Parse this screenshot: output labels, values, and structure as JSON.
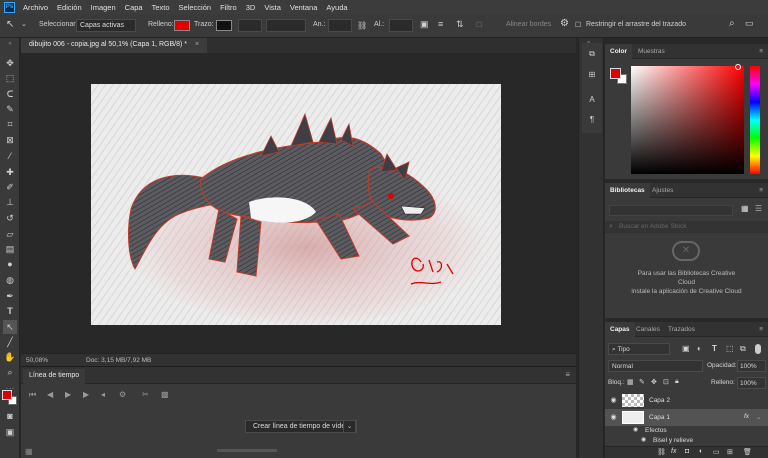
{
  "app": {
    "logo": "Ps"
  },
  "menu": [
    "Archivo",
    "Edición",
    "Imagen",
    "Capa",
    "Texto",
    "Selección",
    "Filtro",
    "3D",
    "Vista",
    "Ventana",
    "Ayuda"
  ],
  "options": {
    "select_label": "Seleccionar:",
    "select_value": "Capas activas",
    "fill_label": "Relleno:",
    "fill_color": "#e00000",
    "stroke_label": "Trazo:",
    "width_label": "An.:",
    "height_label": "Al.:",
    "align_edges": "Alinear bordes",
    "restrict_label": "Restringir el arrastre del trazado"
  },
  "document": {
    "tab_title": "dibujito 006 - copia.jpg al 50,1% (Capa 1, RGB/8) *",
    "zoom": "50,08%",
    "doc_info": "Doc: 3,15 MB/7,92 MB"
  },
  "timeline": {
    "tab": "Línea de tiempo",
    "create_button": "Crear línea de tiempo de vídeo"
  },
  "color_panel": {
    "tabs": [
      "Color",
      "Muestras"
    ],
    "foreground": "#e00000",
    "background": "#ffffff",
    "hue": "#ff0000"
  },
  "libraries_panel": {
    "tabs": [
      "Bibliotecas",
      "Ajustes"
    ],
    "search_placeholder": "Buscar en Adobe Stock",
    "message_line1": "Para usar las Bibliotecas Creative",
    "message_line2": "Cloud",
    "message_line3": "instale la aplicación de Creative Cloud"
  },
  "layers_panel": {
    "tabs": [
      "Capas",
      "Canales",
      "Trazados"
    ],
    "filter_value": "Tipo",
    "blend_mode": "Normal",
    "opacity_label": "Opacidad:",
    "opacity_value": "100%",
    "lock_label": "Bloq.:",
    "fill_label": "Relleno:",
    "fill_value": "100%",
    "layers": [
      {
        "name": "Capa 2"
      },
      {
        "name": "Capa 1",
        "fx": "fx"
      }
    ],
    "effects_label": "Efectos",
    "bevel_label": "Bisel y relieve"
  }
}
